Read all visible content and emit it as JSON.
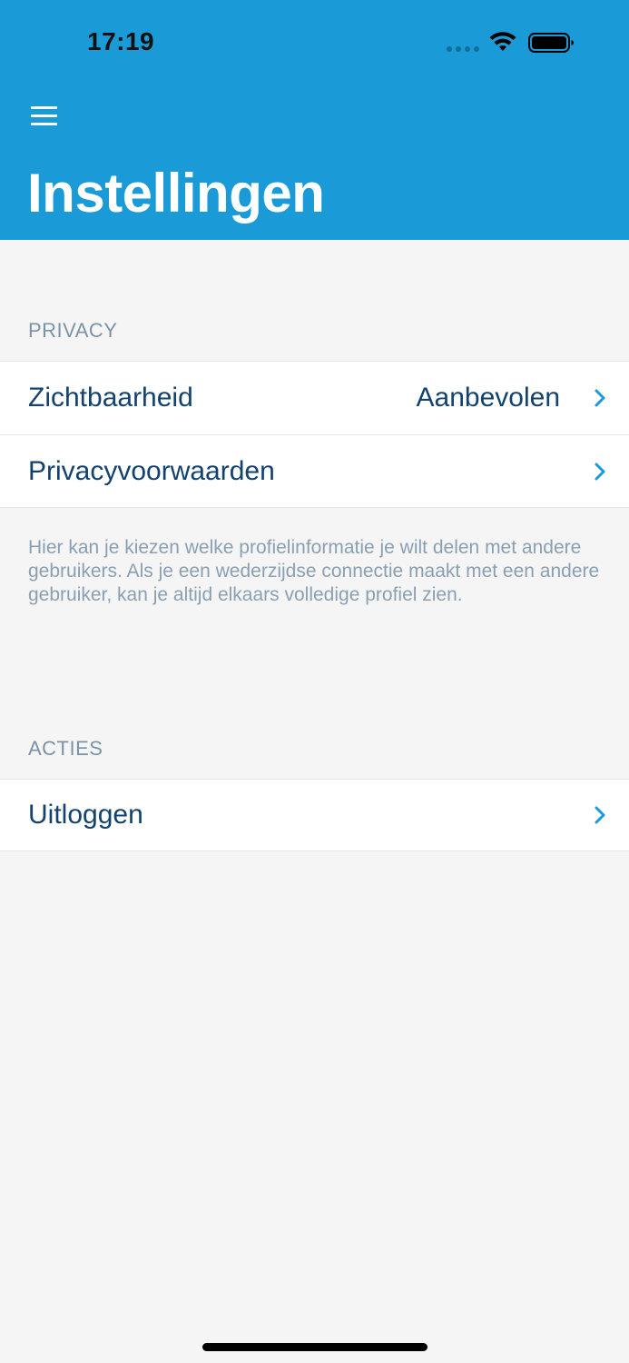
{
  "status_bar": {
    "time": "17:19"
  },
  "header": {
    "menu_icon": "hamburger-menu-icon",
    "title": "Instellingen",
    "background_color": "#1a9bd7"
  },
  "privacy_section": {
    "title": "PRIVACY",
    "rows": [
      {
        "label": "Zichtbaarheid",
        "value": "Aanbevolen"
      },
      {
        "label": "Privacyvoorwaarden"
      }
    ],
    "footer": "Hier kan je kiezen welke profielinformatie je wilt delen met andere gebruikers. Als je een wederzijdse connectie maakt met een andere gebruiker, kan je altijd elkaars volledige profiel zien."
  },
  "actions_section": {
    "title": "ACTIES",
    "rows": [
      {
        "label": "Uitloggen"
      }
    ]
  },
  "colors": {
    "accent": "#1a9bd7",
    "row_text": "#12426d",
    "muted_text": "#7b93a6",
    "chevron": "#1a9bd7",
    "background": "#f5f5f5"
  }
}
